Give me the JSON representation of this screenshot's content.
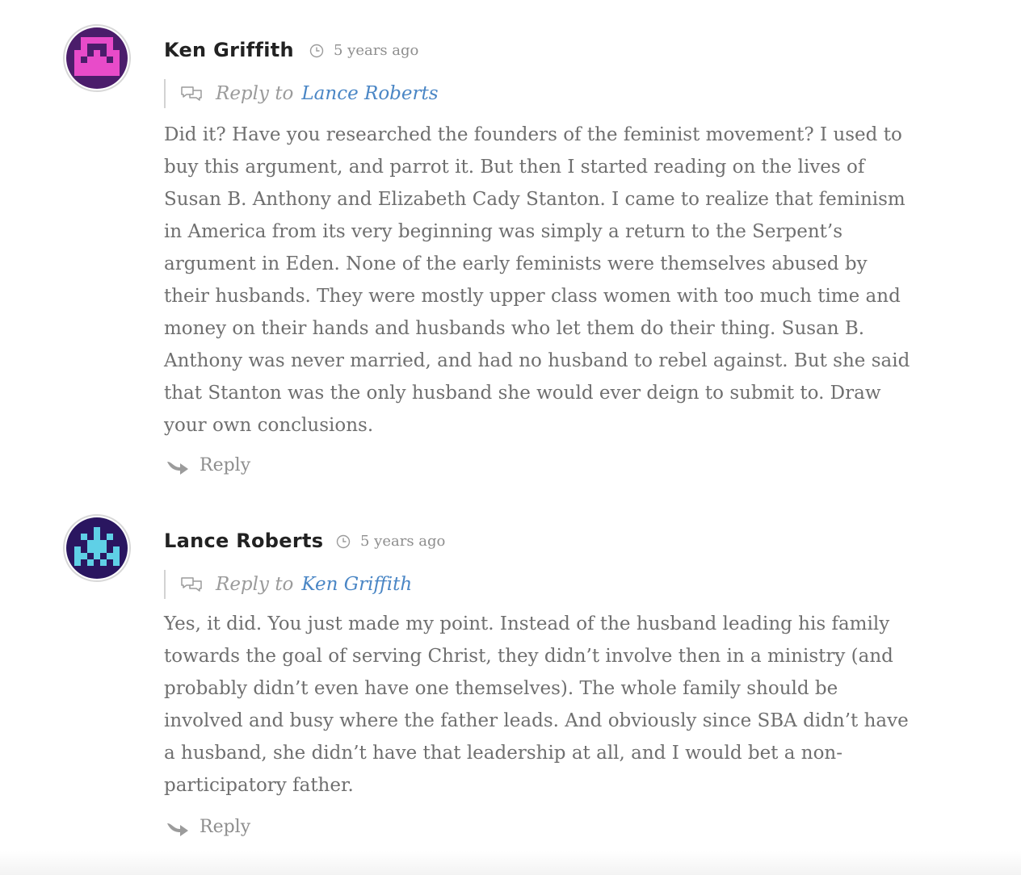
{
  "comments": [
    {
      "author": "Ken Griffith",
      "time": "5 years ago",
      "reply_label": "Reply to",
      "reply_target": "Lance Roberts",
      "body": "Did it? Have you researched the founders of the feminist movement? I used to buy this argument, and parrot it. But then I started reading on the lives of Susan B. Anthony and Elizabeth Cady Stanton. I came to realize that feminism in America from its very beginning was simply a return to the Serpent’s argument in Eden. None of the early feminists were themselves abused by their husbands. They were mostly upper class women with too much time and money on their hands and husbands who let them do their thing. Susan B. Anthony was never married, and had no husband to rebel against. But she said that Stanton was the only husband she would ever deign to submit to. Draw your own conclusions.",
      "reply_button": "Reply",
      "avatar_colors": {
        "background": "#4b1d6b",
        "figure": "#e84bc9"
      },
      "icons": {
        "avatar": "pixel-avatar-icon",
        "time": "clock-icon",
        "reply_to": "chat-bubbles-icon",
        "reply": "reply-arrow-icon"
      }
    },
    {
      "author": "Lance Roberts",
      "time": "5 years ago",
      "reply_label": "Reply to",
      "reply_target": "Ken Griffith",
      "body": "Yes, it did. You just made my point. Instead of the husband leading his family towards the goal of serving Christ, they didn’t involve then in a ministry (and probably didn’t even have one themselves). The whole family should be involved and busy where the father leads. And obviously since SBA didn’t have a husband, she didn’t have that leadership at all, and I would bet a non-participatory father.",
      "reply_button": "Reply",
      "avatar_colors": {
        "background": "#2a1660",
        "figure": "#5fd0e6"
      },
      "icons": {
        "avatar": "pixel-avatar-icon",
        "time": "clock-icon",
        "reply_to": "chat-bubbles-icon",
        "reply": "reply-arrow-icon"
      }
    }
  ],
  "colors": {
    "author": "#222222",
    "meta": "#8e8e8e",
    "body_text": "#6f6f6f",
    "link": "#4a86c5"
  }
}
